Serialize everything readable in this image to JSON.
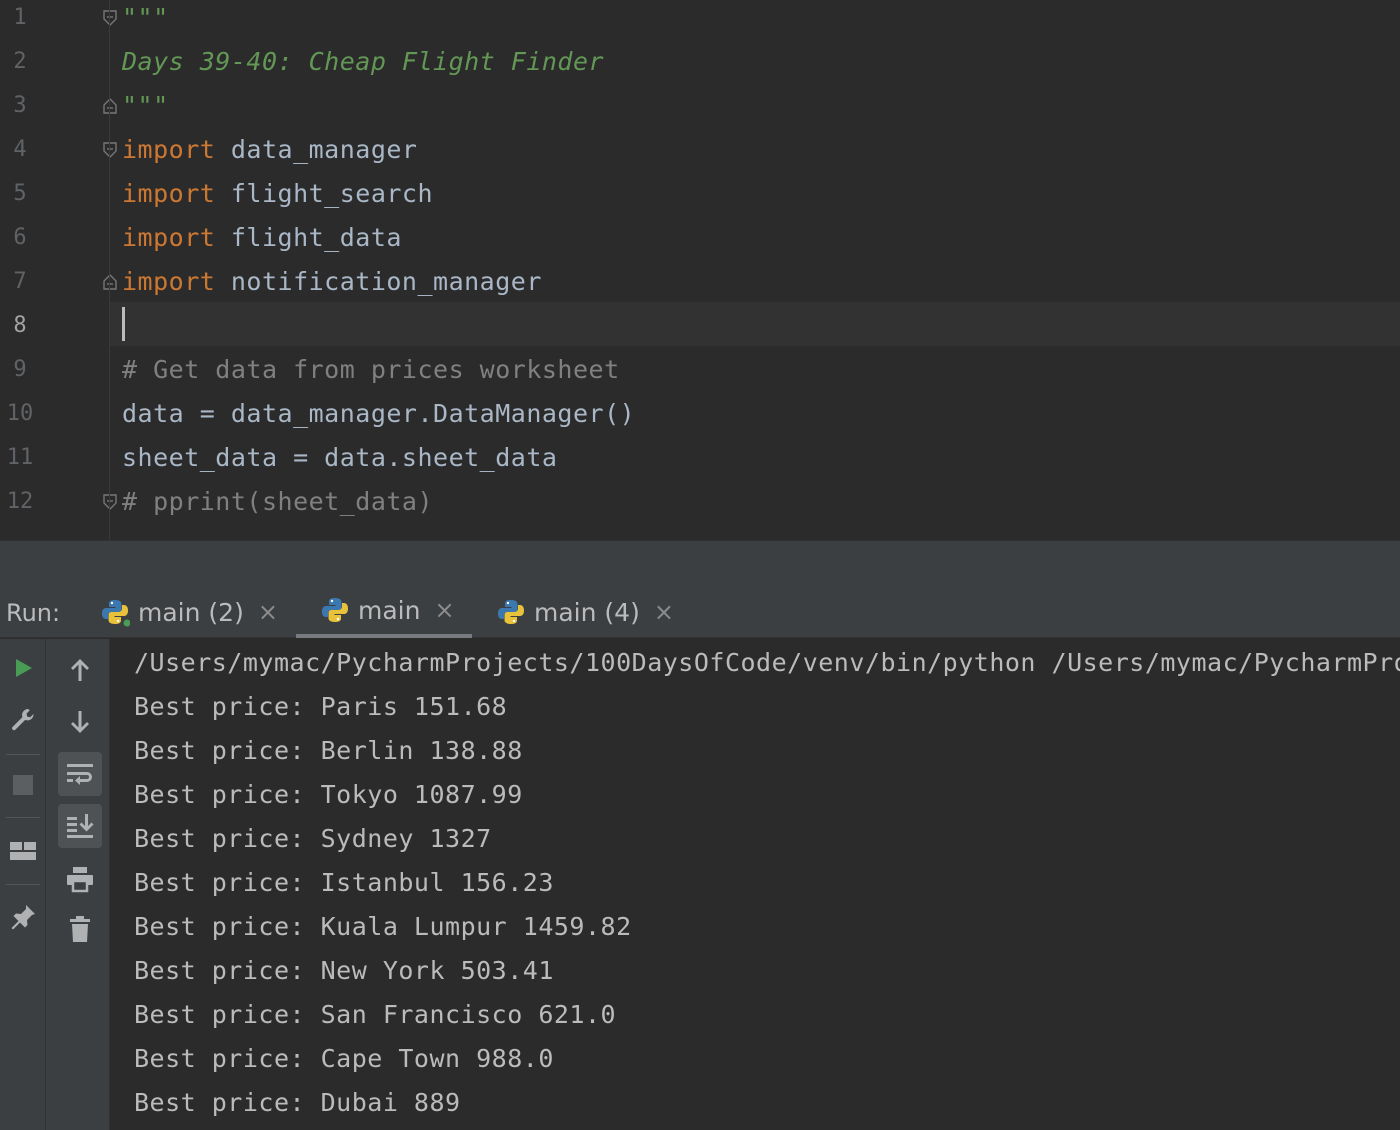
{
  "editor": {
    "line_numbers": [
      "1",
      "2",
      "3",
      "4",
      "5",
      "6",
      "7",
      "8",
      "9",
      "10",
      "11",
      "12"
    ],
    "active_line": "8",
    "lines": [
      {
        "parts": [
          {
            "t": "\"\"\"",
            "c": "doc"
          }
        ]
      },
      {
        "parts": [
          {
            "t": "Days 39-40: Cheap Flight Finder",
            "c": "doc"
          }
        ]
      },
      {
        "parts": [
          {
            "t": "\"\"\"",
            "c": "doc"
          }
        ]
      },
      {
        "parts": [
          {
            "t": "import",
            "c": "kw"
          },
          {
            "t": " data_manager",
            "c": ""
          }
        ]
      },
      {
        "parts": [
          {
            "t": "import",
            "c": "kw"
          },
          {
            "t": " flight_search",
            "c": ""
          }
        ]
      },
      {
        "parts": [
          {
            "t": "import",
            "c": "kw"
          },
          {
            "t": " flight_data",
            "c": ""
          }
        ]
      },
      {
        "parts": [
          {
            "t": "import",
            "c": "kw"
          },
          {
            "t": " notification_manager",
            "c": ""
          }
        ]
      },
      {
        "parts": [
          {
            "t": "",
            "c": ""
          }
        ]
      },
      {
        "parts": [
          {
            "t": "# Get data from prices worksheet",
            "c": "cmt"
          }
        ]
      },
      {
        "parts": [
          {
            "t": "data = data_manager.DataManager()",
            "c": ""
          }
        ]
      },
      {
        "parts": [
          {
            "t": "sheet_data = data.sheet_data",
            "c": ""
          }
        ]
      },
      {
        "parts": [
          {
            "t": "# pprint(sheet_data)",
            "c": "cmt"
          }
        ]
      }
    ]
  },
  "run": {
    "label": "Run:",
    "tabs": [
      {
        "label": "main (2)",
        "close": "×"
      },
      {
        "label": "main",
        "close": "×"
      },
      {
        "label": "main (4)",
        "close": "×"
      }
    ],
    "selected_tab": 1
  },
  "console": {
    "lines": [
      "/Users/mymac/PycharmProjects/100DaysOfCode/venv/bin/python /Users/mymac/PycharmPro",
      "Best price: Paris 151.68",
      "Best price: Berlin 138.88",
      "Best price: Tokyo 1087.99",
      "Best price: Sydney 1327",
      "Best price: Istanbul 156.23",
      "Best price: Kuala Lumpur 1459.82",
      "Best price: New York 503.41",
      "Best price: San Francisco 621.0",
      "Best price: Cape Town 988.0",
      "Best price: Dubai 889"
    ]
  },
  "colors": {
    "keyword": "#cc7832",
    "docstring": "#629755",
    "comment": "#808080",
    "text": "#a9b7c6",
    "run_green": "#499c54"
  },
  "icons": {
    "left_toolbar": [
      "run-icon",
      "wrench-icon",
      "stop-icon",
      "layout-icon",
      "pin-icon"
    ],
    "second_toolbar": [
      "arrow-up-icon",
      "arrow-down-icon",
      "soft-wrap-icon",
      "scroll-to-end-icon",
      "print-icon",
      "trash-icon"
    ]
  }
}
